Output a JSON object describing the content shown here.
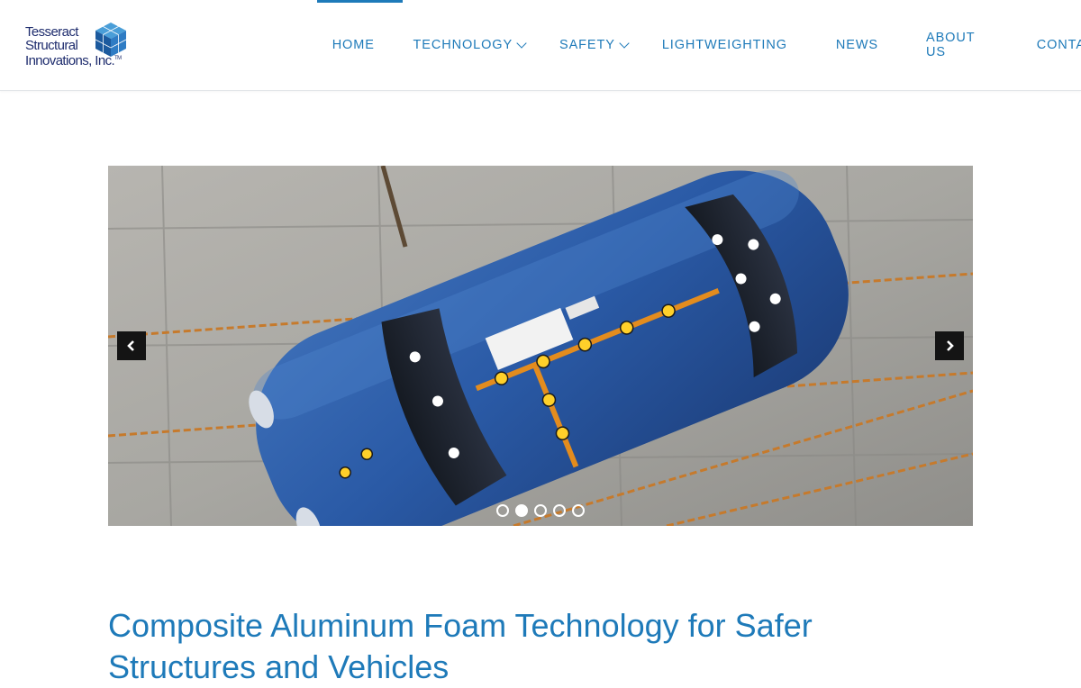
{
  "brand": {
    "line1": "Tesseract",
    "line2": "Structural",
    "line3": "Innovations, Inc.",
    "tm": "TM",
    "logo_icon": "cube-icon",
    "color": "#1f2d6e"
  },
  "nav": {
    "items": [
      {
        "label": "HOME",
        "active": true,
        "has_dropdown": false
      },
      {
        "label": "TECHNOLOGY",
        "active": false,
        "has_dropdown": true
      },
      {
        "label": "SAFETY",
        "active": false,
        "has_dropdown": true
      },
      {
        "label": "LIGHTWEIGHTING",
        "active": false,
        "has_dropdown": false
      },
      {
        "label": "NEWS",
        "active": false,
        "has_dropdown": false
      },
      {
        "label": "ABOUT US",
        "active": false,
        "has_dropdown": false
      },
      {
        "label": "CONTACT",
        "active": false,
        "has_dropdown": false
      }
    ],
    "accent_color": "#1e7ab9"
  },
  "slider": {
    "slide_description_icon": "crash-test-photo",
    "prev_icon": "chevron-left-icon",
    "next_icon": "chevron-right-icon",
    "slide_count": 5,
    "active_slide": 2
  },
  "headline": {
    "text": "Composite Aluminum Foam Technology for Safer Structures and Vehicles"
  }
}
